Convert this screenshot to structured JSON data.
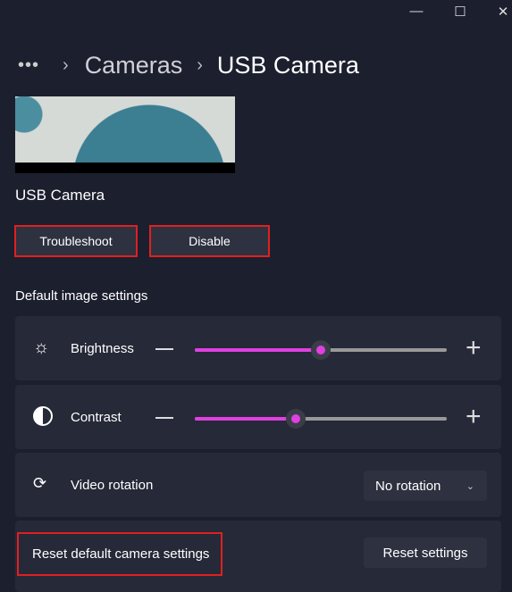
{
  "window": {
    "minimize": "—",
    "maximize": "☐",
    "close": "✕"
  },
  "breadcrumb": {
    "more": "•••",
    "sep": "›",
    "parent": "Cameras",
    "current": "USB Camera"
  },
  "camera_name": "USB Camera",
  "buttons": {
    "troubleshoot": "Troubleshoot",
    "disable": "Disable"
  },
  "section_title": "Default image settings",
  "brightness": {
    "label": "Brightness",
    "value_percent": 50,
    "minus": "—",
    "plus": "+"
  },
  "contrast": {
    "label": "Contrast",
    "value_percent": 40,
    "minus": "—",
    "plus": "+"
  },
  "rotation": {
    "label": "Video rotation",
    "selected": "No rotation"
  },
  "reset": {
    "label": "Reset default camera settings",
    "button": "Reset settings"
  },
  "colors": {
    "accent": "#e040e0",
    "highlight_border": "#e02020"
  }
}
